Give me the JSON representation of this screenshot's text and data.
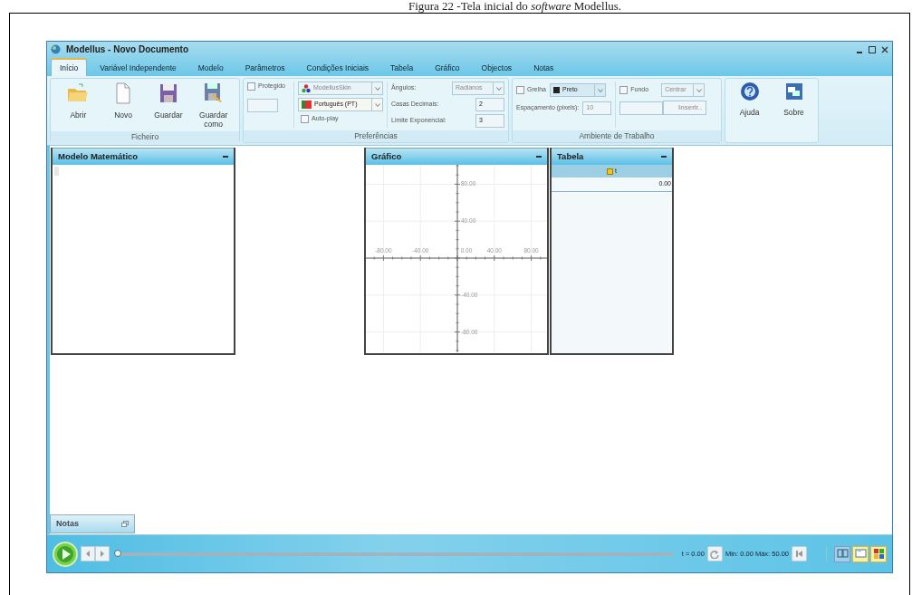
{
  "caption": "Figura 22 -Tela inicial do *software* Modellus.",
  "window": {
    "title": "Modellus - Novo Documento"
  },
  "tabs": [
    {
      "label": "Início",
      "selected": true
    },
    {
      "label": "Variável Independente",
      "selected": false
    },
    {
      "label": "Modelo",
      "selected": false
    },
    {
      "label": "Parâmetros",
      "selected": false
    },
    {
      "label": "Condições Iniciais",
      "selected": false
    },
    {
      "label": "Tabela",
      "selected": false
    },
    {
      "label": "Gráfico",
      "selected": false
    },
    {
      "label": "Objectos",
      "selected": false
    },
    {
      "label": "Notas",
      "selected": false
    }
  ],
  "file_group": {
    "label": "Ficheiro",
    "buttons": [
      {
        "label": "Abrir",
        "kind": "folder"
      },
      {
        "label": "Novo",
        "kind": "page"
      },
      {
        "label": "Guardar",
        "kind": "disk"
      },
      {
        "label": "Guardar como",
        "kind": "disk-edit"
      }
    ]
  },
  "preferences": {
    "label": "Preferências",
    "protected": {
      "label": "Protegido",
      "checked": false
    },
    "skin": {
      "value": "ModellusSkin",
      "disabled": true
    },
    "language": {
      "value": "Português (PT)",
      "disabled": false
    },
    "autoplay": {
      "label": "Auto-play",
      "checked": false
    },
    "angles": {
      "label": "Ângulos:",
      "value": "Radianos",
      "disabled": true
    },
    "decimals": {
      "label": "Casas Decimais:",
      "value": "2"
    },
    "exp_limit": {
      "label": "Limite Exponencial:",
      "value": "3"
    }
  },
  "environment": {
    "label": "Ambiente de Trabalho",
    "grid": {
      "label": "Grelha",
      "checked": false
    },
    "grid_color": {
      "value": "Preto",
      "color": "#222222"
    },
    "spacing": {
      "label": "Espaçamento (pixels):",
      "value": "10",
      "disabled": true
    },
    "background": {
      "label": "Fundo",
      "checked": false
    },
    "position": {
      "value": "Centrar",
      "disabled": true
    },
    "insert_button": {
      "label": "Inserir..",
      "disabled": true
    }
  },
  "help_group": [
    {
      "label": "Ajuda",
      "kind": "help"
    },
    {
      "label": "Sobre",
      "kind": "about"
    }
  ],
  "model_panel": {
    "title": "Modelo Matemático"
  },
  "graph_panel": {
    "title": "Gráfico",
    "x_tick_labels": [
      "-80.00",
      "-40.00",
      "0.00",
      "40.00",
      "80.00"
    ],
    "y_tick_labels": [
      "80.00",
      "40.00",
      "-40.00",
      "-80.00"
    ]
  },
  "table_panel": {
    "title": "Tabela",
    "column": "t",
    "rows": [
      "0.00"
    ]
  },
  "notes_tab": {
    "label": "Notas"
  },
  "player": {
    "slider": {
      "level": 0
    },
    "time": "t  = 0.00",
    "range": "Min: 0.00 Máx: 50.00",
    "views": [
      {
        "kind": "columns",
        "selected": false
      },
      {
        "kind": "panel",
        "selected": true
      },
      {
        "kind": "tiles",
        "selected": true
      }
    ]
  }
}
